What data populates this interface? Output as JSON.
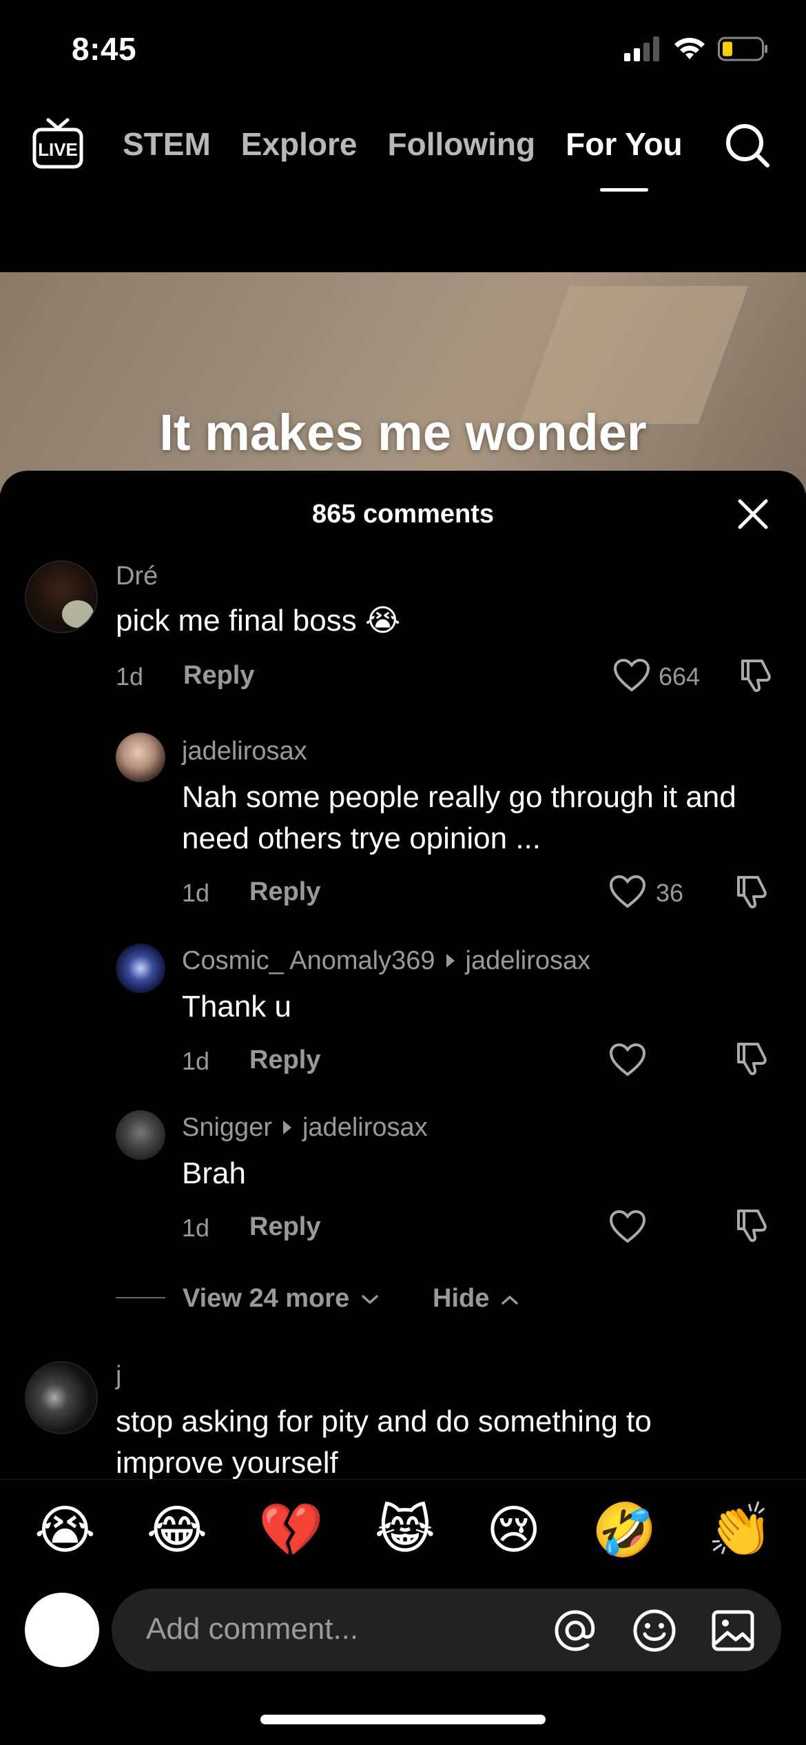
{
  "status_bar": {
    "time": "8:45"
  },
  "top_nav": {
    "live_label": "LIVE",
    "tabs": [
      {
        "label": "STEM"
      },
      {
        "label": "Explore"
      },
      {
        "label": "Following"
      },
      {
        "label": "For You"
      }
    ],
    "active_tab": "For You"
  },
  "video": {
    "caption": "It makes me wonder"
  },
  "comments_sheet": {
    "count_label": "865 comments",
    "comments": [
      {
        "user": "Dré",
        "text": "pick me final boss 😭",
        "age": "1d",
        "reply_label": "Reply",
        "likes": "664"
      },
      {
        "user": "jadelirosax",
        "text": "Nah some people really go through it and need others trye opinion ...",
        "age": "1d",
        "reply_label": "Reply",
        "likes": "36"
      },
      {
        "user": "Cosmic_ Anomaly369",
        "reply_to": "jadelirosax",
        "text": "Thank u",
        "age": "1d",
        "reply_label": "Reply",
        "likes": ""
      },
      {
        "user": "Snigger",
        "reply_to": "jadelirosax",
        "text": "Brah",
        "age": "1d",
        "reply_label": "Reply",
        "likes": ""
      },
      {
        "user": "j",
        "text": "stop asking for pity and do something to improve yourself"
      }
    ],
    "view_more_label": "View 24 more",
    "hide_label": "Hide"
  },
  "composer": {
    "emojis": [
      "😭",
      "😂",
      "💔",
      "😹",
      "😢",
      "🤣",
      "👏"
    ],
    "placeholder": "Add comment..."
  },
  "colors": {
    "background": "#000000",
    "muted_text": "#999999",
    "battery_fill": "#f5d000"
  }
}
